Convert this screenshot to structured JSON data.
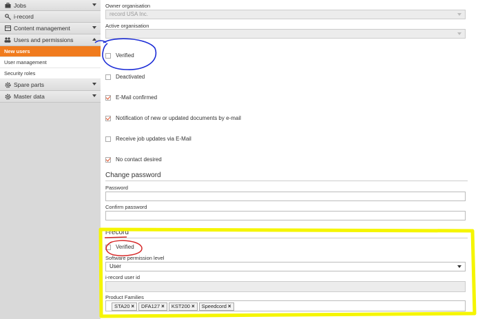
{
  "sidebar": {
    "items": [
      {
        "label": "Jobs",
        "icon": "briefcase-icon"
      },
      {
        "label": "i-record",
        "icon": "key-icon"
      },
      {
        "label": "Content management",
        "icon": "content-icon"
      },
      {
        "label": "Users and permissions",
        "icon": "users-icon"
      }
    ],
    "sub_items": [
      "New users",
      "User management",
      "Security roles"
    ],
    "items_after": [
      {
        "label": "Spare parts",
        "icon": "gear-icon"
      },
      {
        "label": "Master data",
        "icon": "gear-icon"
      }
    ]
  },
  "form": {
    "owner_label": "Owner organisation",
    "owner_value": "record USA Inc.",
    "active_label": "Active organisation",
    "active_value": "",
    "checkboxes": [
      {
        "label": "Verified",
        "checked": false
      },
      {
        "label": "Deactivated",
        "checked": false
      },
      {
        "label": "E-Mail confirmed",
        "checked": true
      },
      {
        "label": "Notification of new or updated documents by e-mail",
        "checked": true
      },
      {
        "label": "Receive job updates via E-Mail",
        "checked": false
      },
      {
        "label": "No contact desired",
        "checked": true
      }
    ],
    "change_password_title": "Change password",
    "password_label": "Password",
    "confirm_label": "Confirm password"
  },
  "irecord": {
    "title": "i-record",
    "verified_label": "Verified",
    "permission_label": "Software permission level",
    "permission_value": "User",
    "user_id_label": "i-record user id",
    "families_label": "Product Families",
    "families": [
      "STA20",
      "DFA127",
      "KST200",
      "Speedcord"
    ]
  },
  "annotations": {
    "blue": "#1a2bd6",
    "red": "#d62a2a",
    "yellow": "#f5f500"
  }
}
